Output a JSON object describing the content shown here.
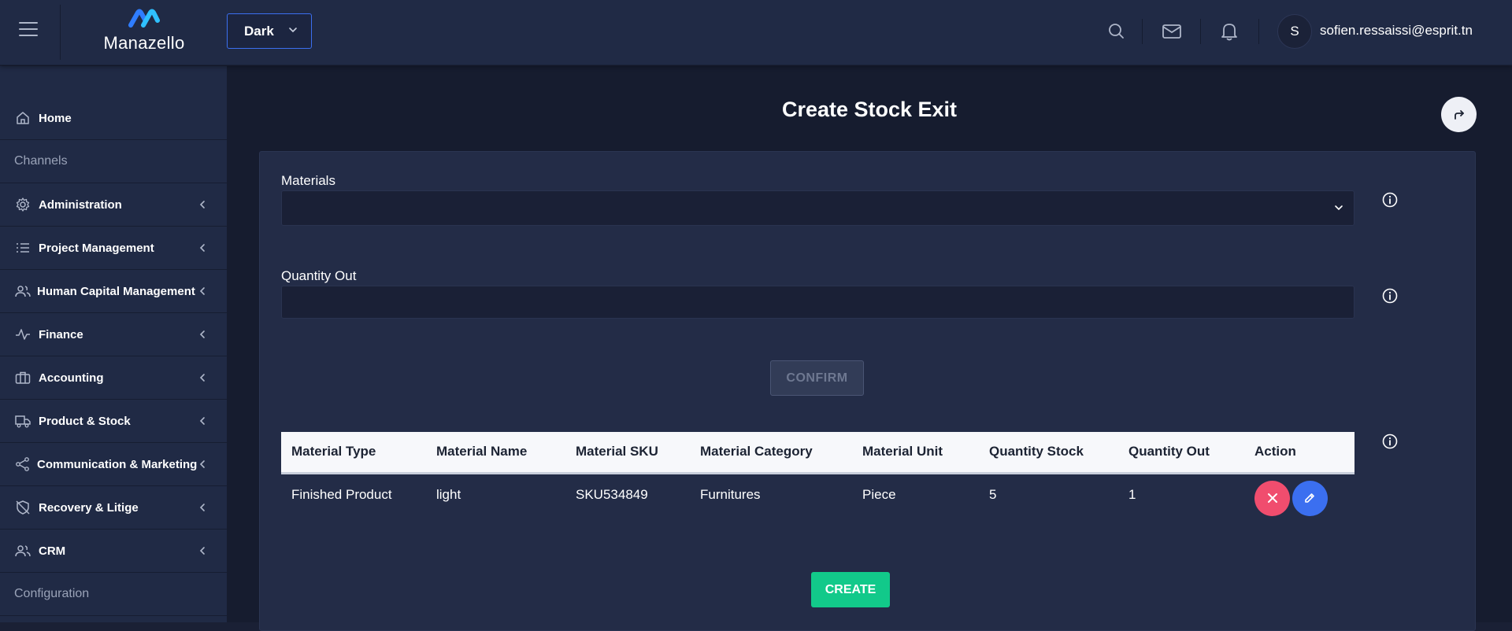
{
  "header": {
    "logo_text": "Manazello",
    "theme_value": "Dark",
    "user_initial": "S",
    "user_email": "sofien.ressaissi@esprit.tn"
  },
  "sidebar": {
    "items": [
      {
        "label": "Home",
        "icon": "home-icon"
      },
      {
        "label": "Channels",
        "section": true
      },
      {
        "label": "Administration",
        "icon": "gear-icon"
      },
      {
        "label": "Project Management",
        "icon": "list-icon"
      },
      {
        "label": "Human Capital Management",
        "icon": "users-icon"
      },
      {
        "label": "Finance",
        "icon": "activity-icon"
      },
      {
        "label": "Accounting",
        "icon": "briefcase-icon"
      },
      {
        "label": "Product & Stock",
        "icon": "truck-icon"
      },
      {
        "label": "Communication & Marketing",
        "icon": "share-icon"
      },
      {
        "label": "Recovery & Litige",
        "icon": "shield-off-icon"
      },
      {
        "label": "CRM",
        "icon": "users-icon"
      },
      {
        "label": "Configuration",
        "section": true
      }
    ]
  },
  "main": {
    "title": "Create Stock Exit",
    "materials_label": "Materials",
    "materials_value": "",
    "quantity_label": "Quantity Out",
    "quantity_value": "",
    "confirm_label": "CONFIRM",
    "create_label": "CREATE",
    "table": {
      "headers": [
        "Material Type",
        "Material Name",
        "Material SKU",
        "Material Category",
        "Material Unit",
        "Quantity Stock",
        "Quantity Out",
        "Action"
      ],
      "rows": [
        [
          "Finished Product",
          "light",
          "SKU534849",
          "Furnitures",
          "Piece",
          "5",
          "1"
        ]
      ]
    }
  },
  "colors": {
    "accent_blue": "#3b6ff0",
    "delete_red": "#f04d6e",
    "create_green": "#12c98a",
    "sidebar_bg": "#202a45",
    "main_bg": "#161c2f"
  }
}
